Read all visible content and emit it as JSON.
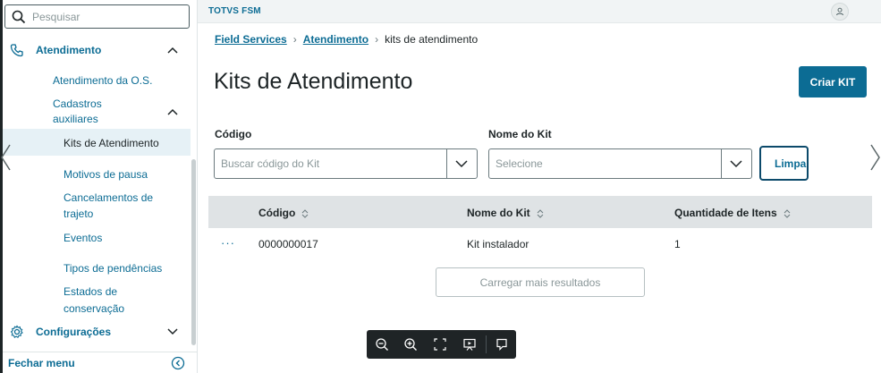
{
  "app": {
    "brand": "TOTVS FSM"
  },
  "sidebar": {
    "search_placeholder": "Pesquisar",
    "items": [
      {
        "label": "Atendimento",
        "level": 0,
        "expanded": true
      },
      {
        "label": "Atendimento da O.S.",
        "level": 1
      },
      {
        "label": "Cadastros auxiliares",
        "level": 1,
        "expanded": true
      },
      {
        "label": "Kits de Atendimento",
        "level": 2,
        "active": true
      },
      {
        "label": "Motivos de pausa",
        "level": 2
      },
      {
        "label": "Cancelamentos de trajeto",
        "level": 2
      },
      {
        "label": "Eventos",
        "level": 2
      },
      {
        "label": "Tipos de pendências",
        "level": 2
      },
      {
        "label": "Estados de conservação",
        "level": 2
      },
      {
        "label": "Configurações",
        "level": 0,
        "expanded": false
      }
    ],
    "footer_label": "Fechar menu"
  },
  "breadcrumb": {
    "items": [
      "Field Services",
      "Atendimento",
      "kits de atendimento"
    ]
  },
  "page": {
    "title": "Kits de Atendimento",
    "create_button": "Criar KIT"
  },
  "filters": {
    "code_label": "Código",
    "code_placeholder": "Buscar código do Kit",
    "name_label": "Nome do Kit",
    "name_placeholder": "Selecione",
    "clear_button": "Limpar"
  },
  "table": {
    "columns": [
      "Código",
      "Nome do Kit",
      "Quantidade de Itens"
    ],
    "rows": [
      {
        "code": "0000000017",
        "name": "Kit instalador",
        "quantity": "1"
      }
    ],
    "load_more": "Carregar mais resultados"
  },
  "colors": {
    "accent": "#0c6c94",
    "header_bg": "#dfe3e5",
    "active_bg": "#e6f1f6",
    "toolbar_bg": "#1f2426"
  }
}
